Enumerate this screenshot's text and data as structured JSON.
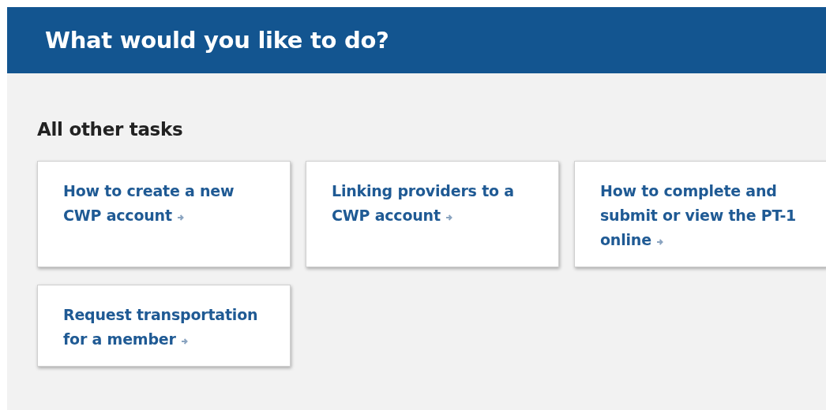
{
  "header": {
    "title": "What would you like to do?"
  },
  "section": {
    "heading": "All other tasks",
    "tasks": [
      {
        "label": "How to create a new CWP account"
      },
      {
        "label": "Linking providers to a CWP account"
      },
      {
        "label": "How to complete and submit or view the PT-1 online"
      },
      {
        "label": "Request transportation for a member"
      }
    ]
  }
}
